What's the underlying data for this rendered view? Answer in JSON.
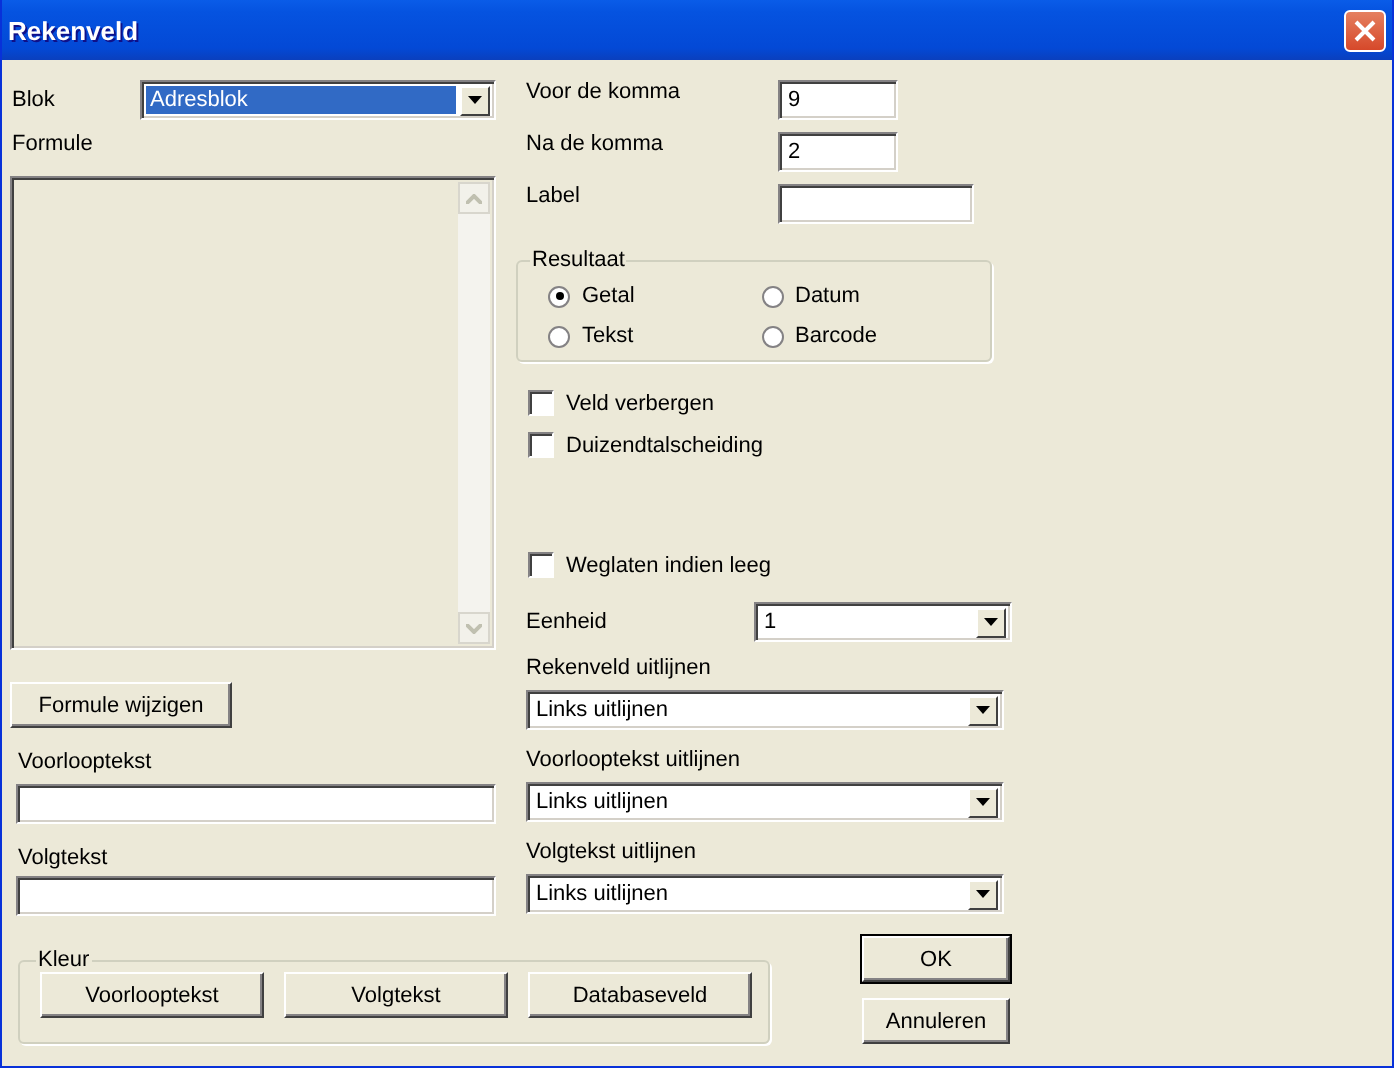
{
  "window": {
    "title": "Rekenveld"
  },
  "block": {
    "label": "Blok",
    "value": "Adresblok",
    "focused": true
  },
  "formula": {
    "label": "Formule",
    "button": "Formule wijzigen"
  },
  "prefix": {
    "label": "Voorlooptekst"
  },
  "suffix": {
    "label": "Volgtekst"
  },
  "number_fields": [
    {
      "label": "Voor de komma",
      "value": "9",
      "wide": false
    },
    {
      "label": "Na de komma",
      "value": "2",
      "wide": false
    },
    {
      "label": "Label",
      "wide": true
    }
  ],
  "result": {
    "title": "Resultaat",
    "options": [
      {
        "label": "Getal",
        "selected": true
      },
      {
        "label": "Datum",
        "selected": false
      },
      {
        "label": "Tekst",
        "selected": false
      },
      {
        "label": "Barcode",
        "selected": false
      }
    ]
  },
  "checkboxes": [
    {
      "label": "Veld verbergen",
      "checked": false
    },
    {
      "label": "Duizendtalscheiding",
      "checked": false
    },
    {
      "label": "Weglaten indien leeg",
      "checked": false
    }
  ],
  "unit": {
    "label": "Eenheid",
    "value": "1"
  },
  "alignments": [
    {
      "label": "Rekenveld uitlijnen",
      "value": "Links uitlijnen"
    },
    {
      "label": "Voorlooptekst uitlijnen",
      "value": "Links uitlijnen"
    },
    {
      "label": "Volgtekst uitlijnen",
      "value": "Links uitlijnen"
    }
  ],
  "color": {
    "title": "Kleur",
    "buttons": [
      "Voorlooptekst",
      "Volgtekst",
      "Databaseveld"
    ]
  },
  "buttons": [
    {
      "label": "OK",
      "default": true
    },
    {
      "label": "Annuleren",
      "default": false
    }
  ]
}
